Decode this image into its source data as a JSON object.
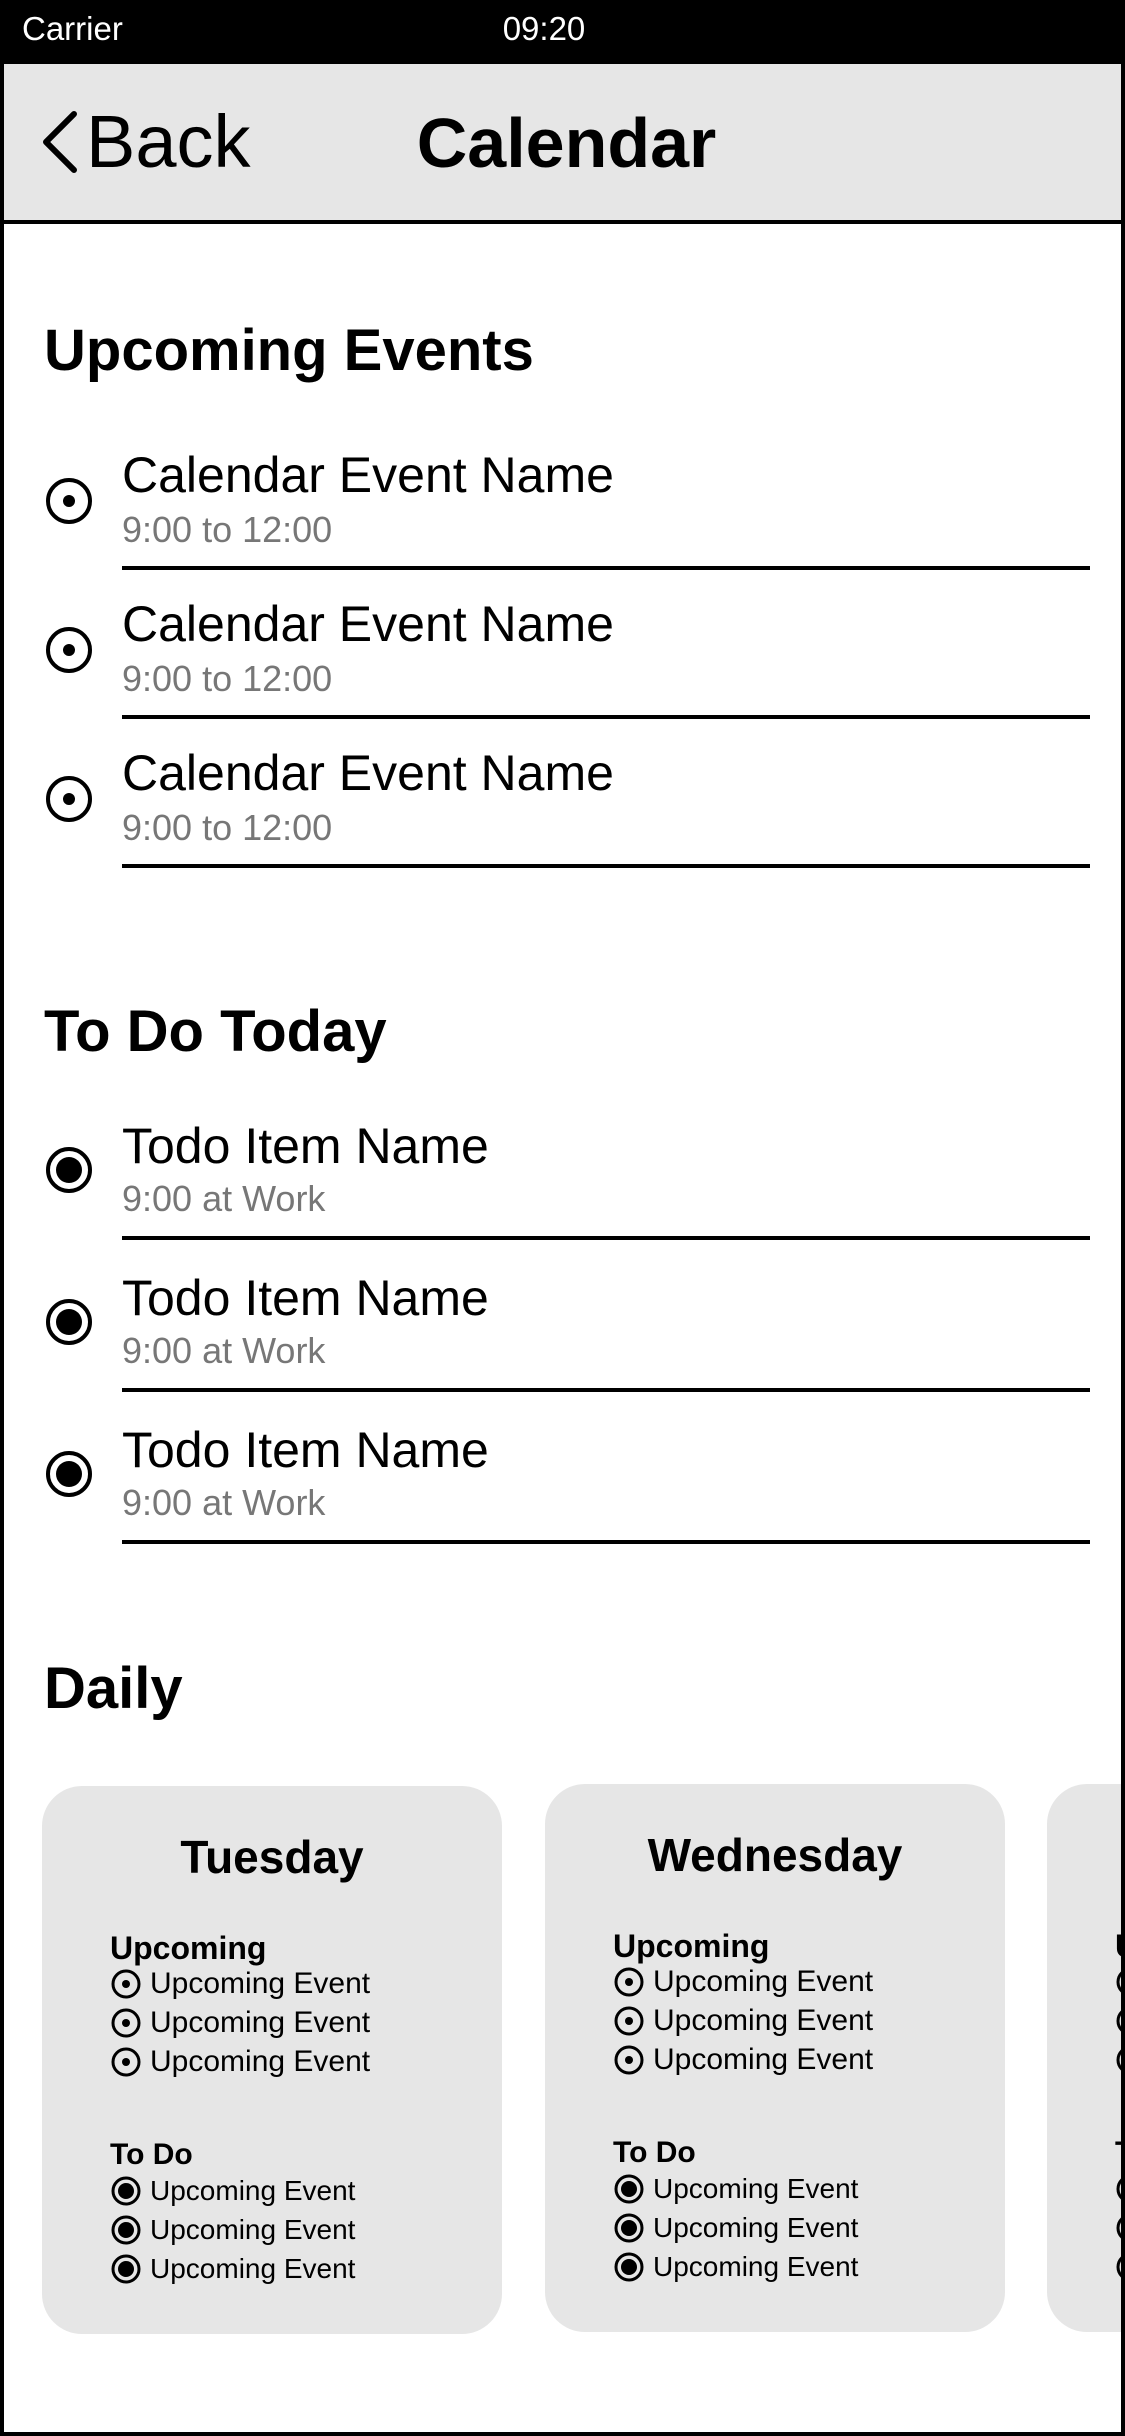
{
  "status_bar": {
    "carrier": "Carrier",
    "time": "09:20"
  },
  "nav": {
    "back_label": "Back",
    "title": "Calendar"
  },
  "upcoming": {
    "title": "Upcoming Events",
    "items": [
      {
        "name": "Calendar Event Name",
        "time": "9:00 to 12:00"
      },
      {
        "name": "Calendar Event Name",
        "time": "9:00 to 12:00"
      },
      {
        "name": "Calendar Event Name",
        "time": "9:00 to 12:00"
      }
    ]
  },
  "todo": {
    "title": "To Do Today",
    "items": [
      {
        "name": "Todo Item Name",
        "detail": "9:00 at Work"
      },
      {
        "name": "Todo Item Name",
        "detail": "9:00 at Work"
      },
      {
        "name": "Todo Item Name",
        "detail": "9:00 at Work"
      }
    ]
  },
  "daily": {
    "title": "Daily",
    "cards": [
      {
        "day": "Tuesday",
        "upcoming_heading": "Upcoming",
        "upcoming": [
          "Upcoming Event",
          "Upcoming Event",
          "Upcoming Event"
        ],
        "todo_heading": "To Do",
        "todo": [
          "Upcoming Event",
          "Upcoming Event",
          "Upcoming Event"
        ]
      },
      {
        "day": "Wednesday",
        "upcoming_heading": "Upcoming",
        "upcoming": [
          "Upcoming Event",
          "Upcoming Event",
          "Upcoming Event"
        ],
        "todo_heading": "To Do",
        "todo": [
          "Upcoming Event",
          "Upcoming Event",
          "Upcoming Event"
        ]
      },
      {
        "day": "",
        "upcoming_heading": "U",
        "upcoming": [
          "",
          "",
          ""
        ],
        "todo_heading": "T",
        "todo": [
          "",
          "",
          ""
        ]
      }
    ]
  },
  "icons": {
    "event": "target-radio-icon",
    "todo": "filled-radio-icon",
    "back": "chevron-left-icon"
  }
}
